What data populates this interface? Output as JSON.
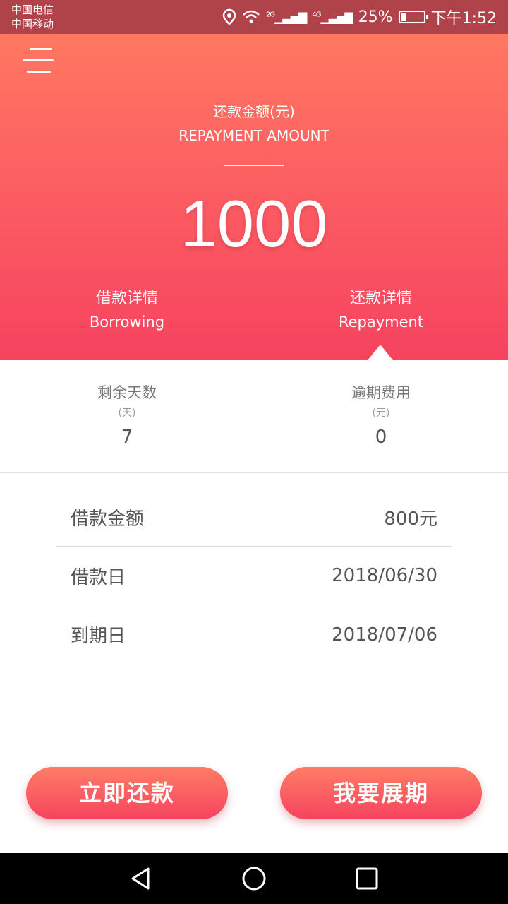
{
  "status_bar": {
    "carrier_1": "中国电信",
    "carrier_2": "中国移动",
    "signal_1": "2G",
    "signal_2": "4G",
    "battery": "25%",
    "time": "下午1:52"
  },
  "hero": {
    "amount_label_cn": "还款金额(元)",
    "amount_label_en": "REPAYMENT AMOUNT",
    "amount_value": "1000",
    "tabs": [
      {
        "cn": "借款详情",
        "en": "Borrowing"
      },
      {
        "cn": "还款详情",
        "en": "Repayment"
      }
    ]
  },
  "summary": {
    "remaining_days": {
      "label": "剩余天数",
      "unit": "(天)",
      "value": "7"
    },
    "overdue_fee": {
      "label": "逾期费用",
      "unit": "(元)",
      "value": "0"
    }
  },
  "details": [
    {
      "key": "借款金额",
      "value": "800元"
    },
    {
      "key": "借款日",
      "value": "2018/06/30"
    },
    {
      "key": "到期日",
      "value": "2018/07/06"
    }
  ],
  "actions": {
    "repay_now": "立即还款",
    "extend": "我要展期"
  },
  "colors": {
    "gradient_top": "#ff7761",
    "gradient_bottom": "#f6435f",
    "status_bar": "#b0424a"
  }
}
